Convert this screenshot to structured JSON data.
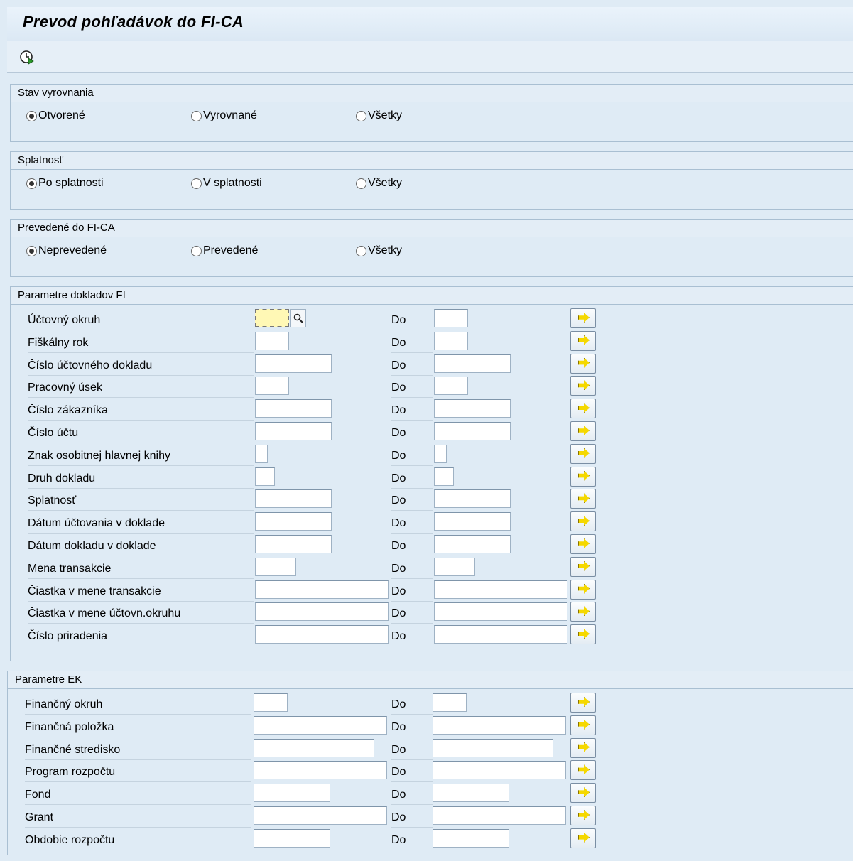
{
  "title": "Prevod pohľadávok do FI-CA",
  "toolbar": {
    "execute_icon": "execute-icon"
  },
  "groups": {
    "stav": {
      "title": "Stav vyrovnania",
      "options": [
        "Otvorené",
        "Vyrovnané",
        "Všetky"
      ],
      "selected": "Otvorené"
    },
    "splatnost": {
      "title": "Splatnosť",
      "options": [
        "Po splatnosti",
        "V splatnosti",
        "Všetky"
      ],
      "selected": "Po splatnosti"
    },
    "prevedene": {
      "title": "Prevedené do FI-CA",
      "options": [
        "Neprevedené",
        "Prevedené",
        "Všetky"
      ],
      "selected": "Neprevedené"
    },
    "fi": {
      "title": "Parametre dokladov FI",
      "to_label": "Do",
      "fields": [
        {
          "label": "Účtovný okruh"
        },
        {
          "label": "Fiškálny rok"
        },
        {
          "label": "Číslo účtovného dokladu"
        },
        {
          "label": "Pracovný úsek"
        },
        {
          "label": "Číslo zákazníka"
        },
        {
          "label": "Číslo účtu"
        },
        {
          "label": "Znak osobitnej hlavnej knihy"
        },
        {
          "label": "Druh dokladu"
        },
        {
          "label": "Splatnosť"
        },
        {
          "label": "Dátum účtovania v doklade"
        },
        {
          "label": "Dátum dokladu v doklade"
        },
        {
          "label": "Mena transakcie"
        },
        {
          "label": "Čiastka v mene transakcie"
        },
        {
          "label": "Čiastka v mene účtovn.okruhu"
        },
        {
          "label": "Číslo priradenia"
        }
      ]
    },
    "ek": {
      "title": "Parametre EK",
      "to_label": "Do",
      "fields": [
        {
          "label": "Finančný okruh"
        },
        {
          "label": "Finančná položka"
        },
        {
          "label": "Finančné stredisko"
        },
        {
          "label": "Program rozpočtu"
        },
        {
          "label": "Fond"
        },
        {
          "label": "Grant"
        },
        {
          "label": "Obdobie rozpočtu"
        }
      ]
    }
  }
}
